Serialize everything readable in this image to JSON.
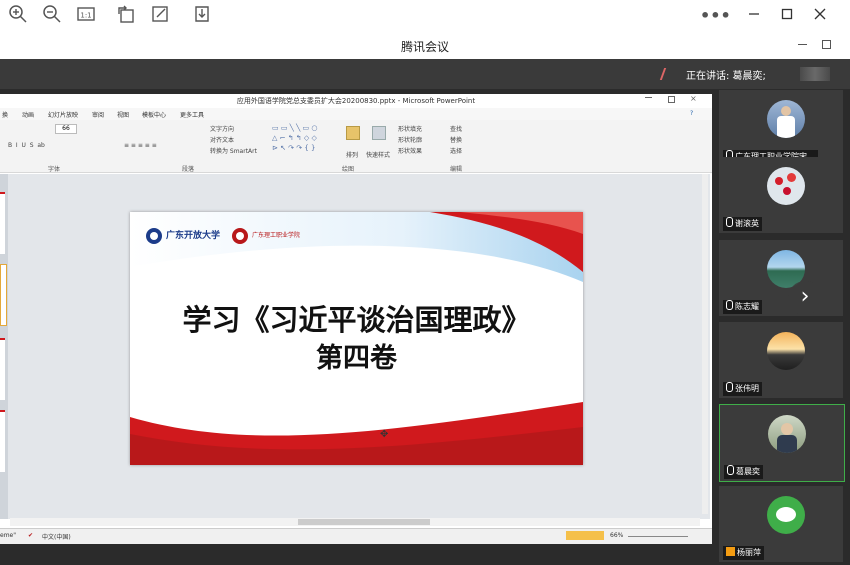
{
  "window": {
    "title": "腾讯会议"
  },
  "toolbar": {
    "icons": [
      "zoom-in-icon",
      "zoom-out-icon",
      "actual-size-icon",
      "rotate-icon",
      "edit-icon",
      "download-icon"
    ],
    "more": "•••"
  },
  "speaking": {
    "label": "正在讲话: 葛晨奕;"
  },
  "ppt": {
    "title": "应用外国语学院党总支委员扩大会20200830.pptx - Microsoft PowerPoint",
    "menu": [
      "换",
      "动画",
      "幻灯片放映",
      "审阅",
      "视图",
      "模板中心",
      "更多工具"
    ],
    "ribbon": {
      "font_group": "字体",
      "para_group": "段落",
      "draw_group": "绘图",
      "edit_group": "编辑",
      "text_dir": "文字方向",
      "align_text": "对齐文本",
      "smartart": "转换为 SmartArt",
      "arrange": "排列",
      "quick_style": "快速样式",
      "shape_fill": "形状填充",
      "shape_outline": "形状轮廓",
      "shape_effect": "形状效果",
      "find": "查找",
      "replace": "替换",
      "select": "选择",
      "font_size": "66"
    },
    "status": {
      "theme": "eme\"",
      "lang": "中文(中国)",
      "zoom": "66%"
    }
  },
  "slide": {
    "logo1": "广东开放大学",
    "logo2": "广东理工职业学院",
    "line1": "学习《习近平谈治国理政》",
    "line2": "第四卷"
  },
  "participants": [
    {
      "name": "广东理工职业学院宋...",
      "avatar": "person-photo"
    },
    {
      "name": "谢滚英",
      "avatar": "berries-photo"
    },
    {
      "name": "陈志耀",
      "avatar": "lake-photo"
    },
    {
      "name": "张伟明",
      "avatar": "sunset-photo"
    },
    {
      "name": "葛晨奕",
      "avatar": "person-photo"
    },
    {
      "name": "杨丽萍",
      "avatar": "wechat-sheep"
    }
  ],
  "colors": {
    "accent_red": "#d0191d",
    "panel": "#2b2b2b",
    "tile": "#3b3b3b",
    "active_border": "#3fae49"
  }
}
